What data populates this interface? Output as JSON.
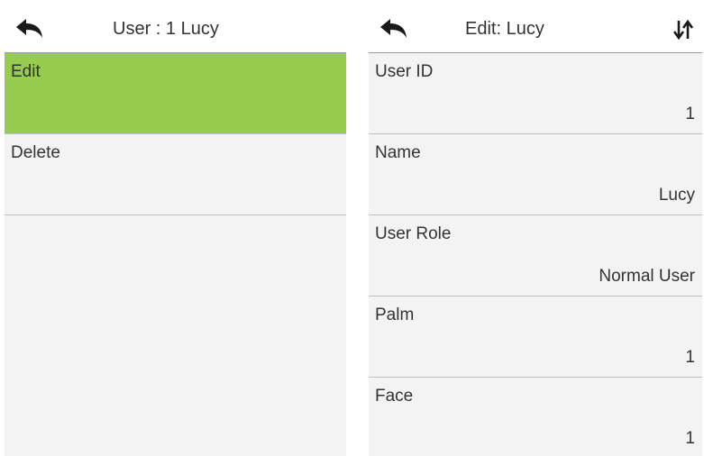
{
  "left_screen": {
    "title": "User : 1 Lucy",
    "back_icon": "back-arrow-icon",
    "menu": [
      {
        "label": "Edit",
        "selected": true
      },
      {
        "label": "Delete",
        "selected": false
      }
    ],
    "colors": {
      "selected": "#96cd4e",
      "background": "#f3f3f3"
    }
  },
  "right_screen": {
    "title": "Edit: Lucy",
    "back_icon": "back-arrow-icon",
    "sort_icon": "sort-arrows-icon",
    "fields": [
      {
        "label": "User ID",
        "value": "1"
      },
      {
        "label": "Name",
        "value": "Lucy"
      },
      {
        "label": "User Role",
        "value": "Normal User"
      },
      {
        "label": "Palm",
        "value": "1"
      },
      {
        "label": "Face",
        "value": "1"
      }
    ]
  }
}
